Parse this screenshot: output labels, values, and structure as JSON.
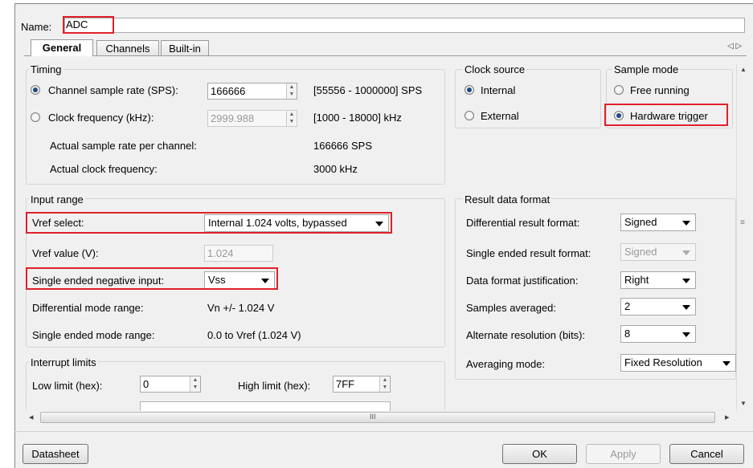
{
  "name": {
    "label": "Name:",
    "value": "ADC"
  },
  "tabs": [
    {
      "label": "General",
      "active": true
    },
    {
      "label": "Channels",
      "active": false
    },
    {
      "label": "Built-in",
      "active": false
    }
  ],
  "tab_arrows": "◁ ▷",
  "timing": {
    "title": "Timing",
    "sample_rate": {
      "label": "Channel sample rate (SPS):",
      "value": "166666",
      "range": "[55556 - 1000000] SPS",
      "selected": true
    },
    "clock_freq": {
      "label": "Clock frequency (kHz):",
      "value": "2999.988",
      "range": "[1000 - 18000] kHz",
      "selected": false
    },
    "actual_rate": {
      "label": "Actual sample rate per channel:",
      "value": "166666 SPS"
    },
    "actual_clock": {
      "label": "Actual clock frequency:",
      "value": "3000 kHz"
    }
  },
  "clock_source": {
    "title": "Clock source",
    "options": [
      {
        "label": "Internal",
        "selected": true
      },
      {
        "label": "External",
        "selected": false
      }
    ]
  },
  "sample_mode": {
    "title": "Sample mode",
    "options": [
      {
        "label": "Free running",
        "selected": false
      },
      {
        "label": "Hardware trigger",
        "selected": true
      }
    ]
  },
  "input_range": {
    "title": "Input range",
    "vref_select": {
      "label": "Vref select:",
      "value": "Internal 1.024 volts, bypassed"
    },
    "vref_value": {
      "label": "Vref value (V):",
      "value": "1.024"
    },
    "single_neg": {
      "label": "Single ended negative input:",
      "value": "Vss"
    },
    "diff_range": {
      "label": "Differential mode range:",
      "value": "Vn +/- 1.024 V"
    },
    "single_range": {
      "label": "Single ended mode range:",
      "value": "0.0 to Vref (1.024 V)"
    }
  },
  "result_format": {
    "title": "Result data format",
    "diff_format": {
      "label": "Differential result format:",
      "value": "Signed"
    },
    "single_format": {
      "label": "Single ended result format:",
      "value": "Signed"
    },
    "justification": {
      "label": "Data format justification:",
      "value": "Right"
    },
    "samples_avg": {
      "label": "Samples averaged:",
      "value": "2"
    },
    "alt_res": {
      "label": "Alternate resolution (bits):",
      "value": "8"
    },
    "avg_mode": {
      "label": "Averaging mode:",
      "value": "Fixed Resolution"
    }
  },
  "interrupt": {
    "title": "Interrupt limits",
    "low": {
      "label": "Low limit (hex):",
      "value": "0"
    },
    "high": {
      "label": "High limit (hex):",
      "value": "7FF"
    }
  },
  "scroll": {
    "grip": "III",
    "left": "◂",
    "right": "▸"
  },
  "buttons": {
    "datasheet": "Datasheet",
    "ok": "OK",
    "apply": "Apply",
    "cancel": "Cancel"
  }
}
